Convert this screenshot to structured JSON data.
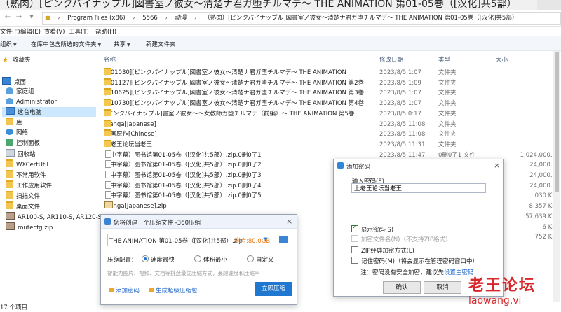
{
  "window": {
    "title": "（熟肉）[ピンクパイナップル]図書室ノ彼女～清楚ナ君ガ堕チルマデ～ THE ANIMATION 第01-05巻（[汉化]共5部）"
  },
  "address": {
    "crumbs": [
      "Program Files (x86)",
      "5566",
      "动漫",
      "（熟肉）[ピンクパイナップル]図書室ノ彼女～清楚ナ君ガ堕チルマデ～ THE ANIMATION 第01-05巻（[汉化]共5部）"
    ]
  },
  "menu": [
    "文件(F)",
    "编辑(E)",
    "查看(V)",
    "工具(T)",
    "帮助(H)"
  ],
  "toolbar": {
    "organize": "组织",
    "include": "在库中包含所选的文件夹",
    "share": "共享",
    "new_folder": "新建文件夹"
  },
  "nav": [
    {
      "label": "收藏夹",
      "icon": "star-icon"
    },
    {
      "label": "桌面",
      "icon": "desktop-icon"
    },
    {
      "label": "家庭组",
      "icon": "homegroup-icon"
    },
    {
      "label": "Administrator",
      "icon": "user-icon"
    },
    {
      "label": "这台电脑",
      "icon": "computer-icon"
    },
    {
      "label": "库",
      "icon": "library-icon"
    },
    {
      "label": "网络",
      "icon": "network-icon"
    },
    {
      "label": "控制面板",
      "icon": "control-panel-icon"
    },
    {
      "label": "回收站",
      "icon": "recycle-bin-icon"
    },
    {
      "label": "WXCertUtil",
      "icon": "folder-icon"
    },
    {
      "label": "不常用软件",
      "icon": "folder-icon"
    },
    {
      "label": "工作应用软件",
      "icon": "folder-icon"
    },
    {
      "label": "扫描文件",
      "icon": "folder-icon"
    },
    {
      "label": "桌面文件",
      "icon": "folder-icon"
    },
    {
      "label": "AR100-S, AR110-S, AR120-S",
      "icon": "archive-icon"
    },
    {
      "label": "routecfg.zip",
      "icon": "archive-icon"
    }
  ],
  "columns": {
    "name": "名称",
    "date": "修改日期",
    "type": "类型",
    "size": "大小"
  },
  "files": [
    {
      "name": "[201030][ピンクパイナップル]図書室ノ彼女～清楚ナ君ガ堕チルマデ～ THE ANIMATION",
      "date": "2023/8/5 1:07",
      "type": "文件夹",
      "size": "",
      "kind": "folder"
    },
    {
      "name": "[201127][ピンクパイナップル]図書室ノ彼女～清楚ナ君ガ堕チルマデ～ THE ANIMATION 第2巻",
      "date": "2023/8/5 1:09",
      "type": "文件夹",
      "size": "",
      "kind": "folder"
    },
    {
      "name": "[210625][ピンクパイナップル]図書室ノ彼女～清楚ナ君ガ堕チルマデ～ THE ANIMATION 第3巻",
      "date": "2023/8/5 1:07",
      "type": "文件夹",
      "size": "",
      "kind": "folder"
    },
    {
      "name": "[210730][ピンクパイナップル]図書室ノ彼女～清楚ナ君ガ堕チルマデ～ THE ANIMATION 第4巻",
      "date": "2023/8/5 1:07",
      "type": "文件夹",
      "size": "",
      "kind": "folder"
    },
    {
      "name": "[ピンクパイナップル]書室ノ彼女～～女教師ガ堕チルマデ（前編）～ THE ANIMATION 第5巻",
      "date": "2023/8/5 0:17",
      "type": "文件夹",
      "size": "",
      "kind": "folder"
    },
    {
      "name": "Manga[Japanese]",
      "date": "2023/8/5 11:08",
      "type": "文件夹",
      "size": "",
      "kind": "folder"
    },
    {
      "name": "漫画原作[Chinese]",
      "date": "2023/8/5 11:08",
      "type": "文件夹",
      "size": "",
      "kind": "folder"
    },
    {
      "name": "上老王论坛当老王",
      "date": "2023/8/5 11:31",
      "type": "文件夹",
      "size": "",
      "kind": "folder"
    },
    {
      "name": "（中字幕）图书馆第01-05卷（[汉化]共5部）.zip.0删0了1",
      "date": "2023/8/5 11:47",
      "type": "0删0了1 文件",
      "size": "1,024,000...",
      "kind": "file"
    },
    {
      "name": "（中字幕）图书馆第01-05卷（[汉化]共5部）.zip.0删0了2",
      "date": "",
      "type": "",
      "size": "24,000...",
      "kind": "file"
    },
    {
      "name": "（中字幕）图书馆第01-05卷（[汉化]共5部）.zip.0删0了3",
      "date": "",
      "type": "",
      "size": "24,000...",
      "kind": "file"
    },
    {
      "name": "（中字幕）图书馆第01-05卷（[汉化]共5部）.zip.0删0了4",
      "date": "",
      "type": "",
      "size": "24,000...",
      "kind": "file"
    },
    {
      "name": "（中字幕）图书馆第01-05卷（[汉化]共5部）.zip.0删0了5",
      "date": "",
      "type": "",
      "size": "030 KB",
      "kind": "file"
    },
    {
      "name": "Manga[Japanese].zip",
      "date": "",
      "type": "",
      "size": "8,357 KB",
      "kind": "zip"
    },
    {
      "name": "",
      "date": "",
      "type": "",
      "size": "57,639 KB",
      "kind": "blank"
    },
    {
      "name": "",
      "date": "",
      "type": "",
      "size": "6 KB",
      "kind": "blank"
    },
    {
      "name": "",
      "date": "",
      "type": "",
      "size": "752 KB",
      "kind": "blank"
    }
  ],
  "status": {
    "count": "17 个项目"
  },
  "password_dialog": {
    "title": "添加密码",
    "input_label": "输入密码(E)",
    "input_value": "上老王论坛当老王",
    "show_password": "显示密码(S)",
    "encrypt_names": "加密文件名(N)（不支持ZIP格式）",
    "zip_classic": "ZIP经典加密方式(L)",
    "remember": "记住密码(M)（将会显示在管理密码窗口中）",
    "note_prefix": "注：密码没有安全加密，建议先",
    "note_link": "设置主密码",
    "ok": "确认",
    "cancel": "取消"
  },
  "zip_dialog": {
    "title": "您将创建一个压缩文件 -360压缩",
    "filename": "THE ANIMATION 第01-05卷（[汉化]共5部）.zip",
    "free_space": "剩余:80.0GB",
    "mode_label": "压缩配置：",
    "modes": [
      "速度最快",
      "体积最小",
      "自定义"
    ],
    "hint": "智能为图片、视频、文档等挑选最优压缩方式，兼顾速度和压缩率",
    "add_password": "添加密码",
    "self_extract": "生成超级压缩包",
    "start": "立即压缩"
  },
  "watermark": {
    "text": "老王论坛",
    "url": "laowang.vi"
  },
  "colors": {
    "accent": "#1f77d0",
    "selected": "#cce8ff",
    "watermark": "#d8282b"
  }
}
